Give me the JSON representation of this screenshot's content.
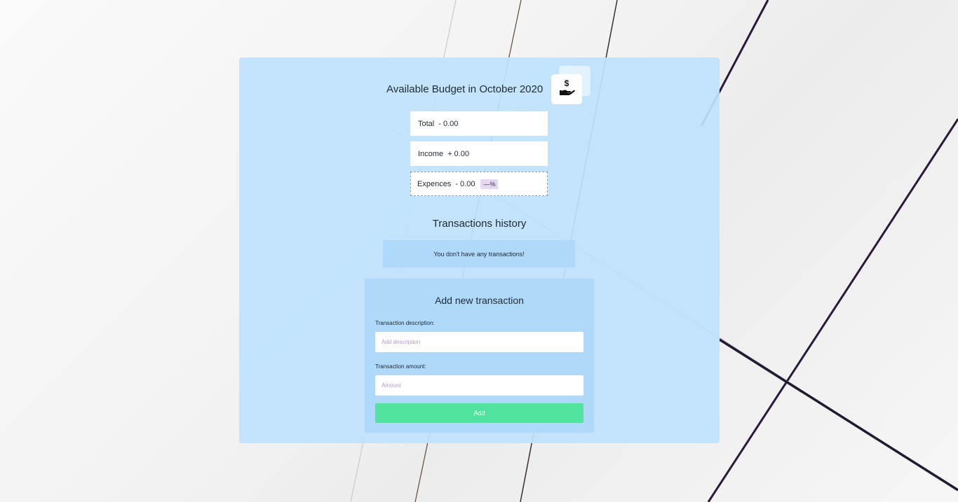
{
  "header": {
    "budget_title": "Available Budget in October 2020",
    "logo_icon": "hand-dollar-icon"
  },
  "summary": {
    "total_label": "Total",
    "total_value": "- 0.00",
    "income_label": "Income",
    "income_value": "+ 0.00",
    "expences_label": "Expences",
    "expences_value": "- 0.00",
    "expences_percentage": "—%"
  },
  "history": {
    "title": "Transactions history",
    "empty_message": "You don't have any transactions!"
  },
  "form": {
    "title": "Add new transaction",
    "description_label": "Transaction description:",
    "description_placeholder": "Add description",
    "description_value": "",
    "amount_label": "Transaction amount:",
    "amount_placeholder": "Amount",
    "amount_value": "",
    "add_button_label": "Add"
  },
  "colors": {
    "panel": "#c2e4fb",
    "form_panel": "#aed9fa",
    "add_button": "#52e29f",
    "percentage_badge": "#e6d8f2"
  }
}
